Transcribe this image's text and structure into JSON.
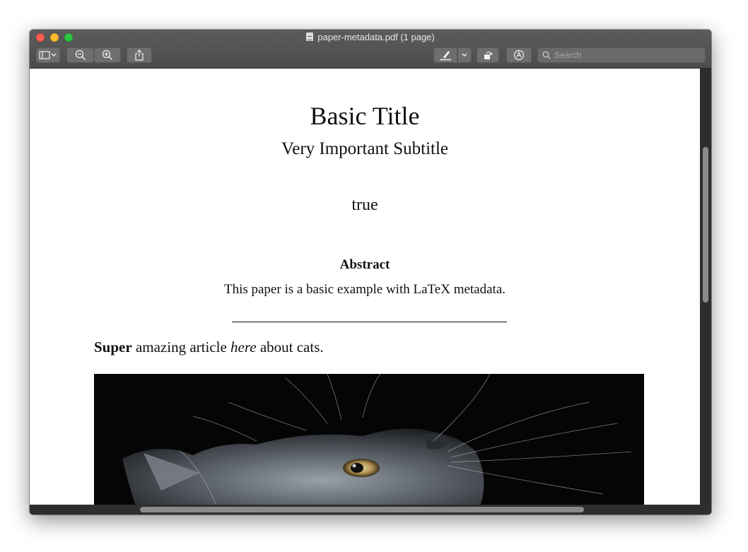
{
  "window": {
    "title": "paper-metadata.pdf (1 page)"
  },
  "toolbar": {
    "sidebar_icon": "sidebar-toggle-icon",
    "zoom_out_icon": "zoom-out-icon",
    "zoom_in_icon": "zoom-in-icon",
    "share_icon": "share-icon",
    "highlight_icon": "highlighter-icon",
    "rotate_icon": "rotate-icon",
    "markup_icon": "markup-icon",
    "search_placeholder": "Search"
  },
  "document": {
    "title": "Basic Title",
    "subtitle": "Very Important Subtitle",
    "author": "true",
    "abstract_heading": "Abstract",
    "abstract_text": "This paper is a basic example with LaTeX metadata.",
    "body_bold": "Super",
    "body_text_1": " amazing article ",
    "body_italic": "here",
    "body_text_2": " about cats.",
    "figure_alt": "cat photo"
  }
}
